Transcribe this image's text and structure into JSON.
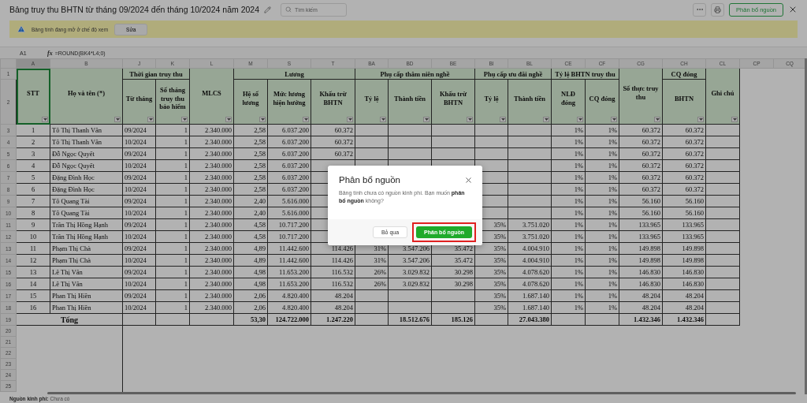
{
  "title": "Bảng truy thu BHTN từ tháng 09/2024 đến tháng 10/2024 năm 2024",
  "search": {
    "placeholder": "Tìm kiếm"
  },
  "allocate_button": "Phân bổ nguồn",
  "banner": {
    "message": "Bảng tính đang mở ở chế độ xem",
    "button": "Sửa"
  },
  "formula_bar": {
    "cell": "A1",
    "fx": "fx",
    "formula": "=ROUND(BK4*L4;0)"
  },
  "column_letters": [
    {
      "label": "A",
      "selected": true
    },
    {
      "label": "B",
      "selected": false
    },
    {
      "label": "J",
      "selected": false
    },
    {
      "label": "K",
      "selected": false
    },
    {
      "label": "L",
      "selected": false
    },
    {
      "label": "M",
      "selected": false
    },
    {
      "label": "S",
      "selected": false
    },
    {
      "label": "T",
      "selected": false
    },
    {
      "label": "BA",
      "selected": false
    },
    {
      "label": "BD",
      "selected": false
    },
    {
      "label": "BE",
      "selected": false
    },
    {
      "label": "BI",
      "selected": false
    },
    {
      "label": "BL",
      "selected": false
    },
    {
      "label": "CE",
      "selected": false
    },
    {
      "label": "CF",
      "selected": false
    },
    {
      "label": "CG",
      "selected": false
    },
    {
      "label": "CH",
      "selected": false
    },
    {
      "label": "CL",
      "selected": false
    },
    {
      "label": "CP",
      "selected": false
    },
    {
      "label": "CQ",
      "selected": false
    }
  ],
  "header_row_numbers": [
    "1",
    "2"
  ],
  "header_groups": [
    {
      "label": "STT"
    },
    {
      "label": "Họ và tên (*)"
    },
    {
      "label": "Thời gian truy thu",
      "children": [
        {
          "label": "Từ tháng"
        },
        {
          "label": "Số tháng truy thu bảo hiểm"
        }
      ]
    },
    {
      "label": "MLCS"
    },
    {
      "label": "Lương",
      "children": [
        {
          "label": "Hệ số lương"
        },
        {
          "label": "Mức lương hiện hưởng"
        },
        {
          "label": "Khấu trừ BHTN"
        }
      ]
    },
    {
      "label": "Phụ cấp thâm niên nghề",
      "children": [
        {
          "label": "Tỷ lệ"
        },
        {
          "label": "Thành tiền"
        },
        {
          "label": "Khấu trừ BHTN"
        }
      ]
    },
    {
      "label": "Phụ cấp ưu đãi nghề",
      "children": [
        {
          "label": "Tỷ lệ"
        },
        {
          "label": "Thành tiền"
        }
      ]
    },
    {
      "label": "Tỷ lệ BHTN truy thu",
      "children": [
        {
          "label": "NLĐ đóng"
        },
        {
          "label": "CQ đóng"
        }
      ]
    },
    {
      "label": "Số thực truy thu"
    },
    {
      "label": "CQ đóng",
      "children": [
        {
          "label": "BHTN"
        }
      ]
    },
    {
      "label": "Ghi chú"
    }
  ],
  "rows": [
    {
      "number": "3",
      "cells": [
        "1",
        "Tô Thị Thanh Vân",
        "09/2024",
        "1",
        "2.340.000",
        "2,58",
        "6.037.200",
        "60.372",
        null,
        null,
        null,
        null,
        null,
        "1%",
        "1%",
        "60.372",
        "60.372",
        null
      ]
    },
    {
      "number": "4",
      "cells": [
        "2",
        "Tô Thị Thanh Vân",
        "10/2024",
        "1",
        "2.340.000",
        "2,58",
        "6.037.200",
        "60.372",
        null,
        null,
        null,
        null,
        null,
        "1%",
        "1%",
        "60.372",
        "60.372",
        null
      ]
    },
    {
      "number": "5",
      "cells": [
        "3",
        "Đỗ Ngọc Quyết",
        "09/2024",
        "1",
        "2.340.000",
        "2,58",
        "6.037.200",
        "60.372",
        null,
        null,
        null,
        null,
        null,
        "1%",
        "1%",
        "60.372",
        "60.372",
        null
      ]
    },
    {
      "number": "6",
      "cells": [
        "4",
        "Đỗ Ngọc Quyết",
        "10/2024",
        "1",
        "2.340.000",
        "2,58",
        "6.037.200",
        null,
        null,
        null,
        null,
        null,
        null,
        "1%",
        "1%",
        "60.372",
        "60.372",
        null
      ]
    },
    {
      "number": "7",
      "cells": [
        "5",
        "Đặng Đình Học",
        "09/2024",
        "1",
        "2.340.000",
        "2,58",
        "6.037.200",
        null,
        null,
        null,
        null,
        null,
        null,
        "1%",
        "1%",
        "60.372",
        "60.372",
        null
      ]
    },
    {
      "number": "8",
      "cells": [
        "6",
        "Đặng Đình Học",
        "10/2024",
        "1",
        "2.340.000",
        "2,58",
        "6.037.200",
        null,
        null,
        null,
        null,
        null,
        null,
        "1%",
        "1%",
        "60.372",
        "60.372",
        null
      ]
    },
    {
      "number": "9",
      "cells": [
        "7",
        "Tô Quang Tài",
        "09/2024",
        "1",
        "2.340.000",
        "2,40",
        "5.616.000",
        null,
        null,
        null,
        null,
        null,
        null,
        "1%",
        "1%",
        "56.160",
        "56.160",
        null
      ]
    },
    {
      "number": "10",
      "cells": [
        "8",
        "Tô Quang Tài",
        "10/2024",
        "1",
        "2.340.000",
        "2,40",
        "5.616.000",
        null,
        null,
        null,
        null,
        null,
        null,
        "1%",
        "1%",
        "56.160",
        "56.160",
        null
      ]
    },
    {
      "number": "11",
      "cells": [
        "9",
        "Trần Thị Hồng Hạnh",
        "09/2024",
        "1",
        "2.340.000",
        "4,58",
        "10.717.200",
        null,
        null,
        null,
        null,
        "35%",
        "3.751.020",
        "1%",
        "1%",
        "133.965",
        "133.965",
        null
      ]
    },
    {
      "number": "12",
      "cells": [
        "10",
        "Trần Thị Hồng Hạnh",
        "10/2024",
        "1",
        "2.340.000",
        "4,58",
        "10.717.200",
        null,
        null,
        null,
        null,
        "35%",
        "3.751.020",
        "1%",
        "1%",
        "133.965",
        "133.965",
        null
      ]
    },
    {
      "number": "13",
      "cells": [
        "11",
        "Phạm Thị Chà",
        "09/2024",
        "1",
        "2.340.000",
        "4,89",
        "11.442.600",
        "114.426",
        "31%",
        "3.547.206",
        "35.472",
        "35%",
        "4.004.910",
        "1%",
        "1%",
        "149.898",
        "149.898",
        null
      ]
    },
    {
      "number": "14",
      "cells": [
        "12",
        "Phạm Thị Chà",
        "10/2024",
        "1",
        "2.340.000",
        "4,89",
        "11.442.600",
        "114.426",
        "31%",
        "3.547.206",
        "35.472",
        "35%",
        "4.004.910",
        "1%",
        "1%",
        "149.898",
        "149.898",
        null
      ]
    },
    {
      "number": "15",
      "cells": [
        "13",
        "Lê Thị Vân",
        "09/2024",
        "1",
        "2.340.000",
        "4,98",
        "11.653.200",
        "116.532",
        "26%",
        "3.029.832",
        "30.298",
        "35%",
        "4.078.620",
        "1%",
        "1%",
        "146.830",
        "146.830",
        null
      ]
    },
    {
      "number": "16",
      "cells": [
        "14",
        "Lê Thị Vân",
        "10/2024",
        "1",
        "2.340.000",
        "4,98",
        "11.653.200",
        "116.532",
        "26%",
        "3.029.832",
        "30.298",
        "35%",
        "4.078.620",
        "1%",
        "1%",
        "146.830",
        "146.830",
        null
      ]
    },
    {
      "number": "17",
      "cells": [
        "15",
        "Phan Thị Hiền",
        "09/2024",
        "1",
        "2.340.000",
        "2,06",
        "4.820.400",
        "48.204",
        null,
        null,
        null,
        "35%",
        "1.687.140",
        "1%",
        "1%",
        "48.204",
        "48.204",
        null
      ]
    },
    {
      "number": "18",
      "cells": [
        "16",
        "Phan Thị Hiền",
        "10/2024",
        "1",
        "2.340.000",
        "2,06",
        "4.820.400",
        "48.204",
        null,
        null,
        null,
        "35%",
        "1.687.140",
        "1%",
        "1%",
        "48.204",
        "48.204",
        null
      ]
    }
  ],
  "total_row": {
    "number": "19",
    "label": "Tổng",
    "cells": [
      null,
      null,
      null,
      "53,30",
      "124.722.000",
      "1.247.220",
      null,
      "18.512.676",
      "185.126",
      null,
      "27.043.380",
      null,
      null,
      "1.432.346",
      "1.432.346",
      null
    ]
  },
  "empty_row_numbers": [
    "20",
    "21",
    "22",
    "23",
    "24",
    "25"
  ],
  "footer": {
    "label": "Nguồn kinh phí:",
    "value": "Chưa có"
  },
  "dialog": {
    "title": "Phân bổ nguồn",
    "message": "Bảng tính chưa có nguồn kinh phí. Bạn muốn **phân bổ nguồn** không?",
    "buttons": [
      {
        "label": "Bỏ qua",
        "kind": "secondary",
        "highlighted": false
      },
      {
        "label": "Phân bổ nguồn",
        "kind": "primary",
        "highlighted": true
      }
    ]
  }
}
